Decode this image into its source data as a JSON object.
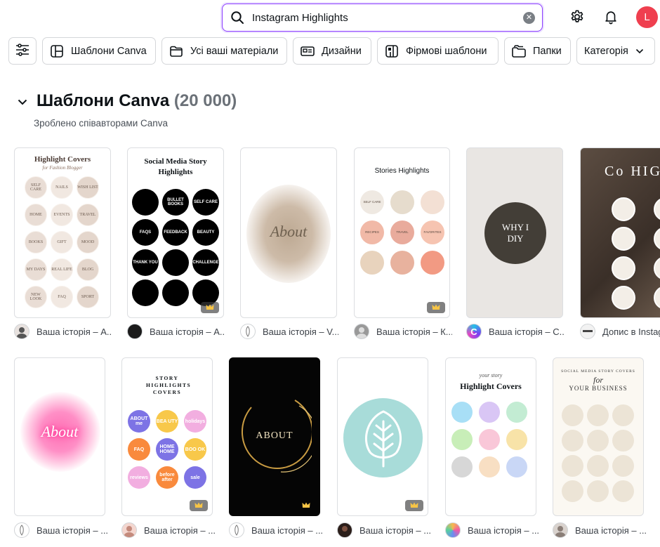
{
  "search": {
    "value": "Instagram Highlights",
    "placeholder": "Instagram Highlights"
  },
  "header": {
    "avatar_letter": "L"
  },
  "filters": [
    {
      "label": "Шаблони Canva"
    },
    {
      "label": "Усі ваші матеріали"
    },
    {
      "label": "Дизайни"
    },
    {
      "label": "Фірмові шаблони"
    },
    {
      "label": "Папки"
    },
    {
      "label": "Категорія"
    }
  ],
  "section": {
    "title": "Шаблони Canva",
    "count": "(20 000)",
    "subtitle": "Зроблено співавторами Canva"
  },
  "cards": [
    {
      "caption": "Ваша історія – А...",
      "title": "Highlight Covers",
      "subtitle": "for Fashion Blogger",
      "labels": [
        "SELF CARE",
        "NAILS",
        "WISH LIST",
        "HOME",
        "EVENTS",
        "TRAVEL",
        "BOOKS",
        "GIFT",
        "MOOD",
        "MY DAYS",
        "REAL LIFE",
        "BLOG",
        "NEW LOOK",
        "FAQ",
        "SPORT"
      ]
    },
    {
      "caption": "Ваша історія – А...",
      "title": "Social Media Story Highlights",
      "labels": [
        "",
        "BULLET BOOKS",
        "SELF CARE",
        "FAQS",
        "FEEDBACK",
        "BEAUTY",
        "THANK YOU",
        "",
        "CHALLENGE",
        "",
        "",
        ""
      ]
    },
    {
      "caption": "Ваша історія – V...",
      "word": "About"
    },
    {
      "caption": "Ваша історія – К...",
      "title": "Stories Highlights",
      "labels": [
        "SELF CARE",
        "",
        "",
        "RECIPES",
        "TRAVEL",
        "FAVORITES",
        "",
        "",
        ""
      ]
    },
    {
      "caption": "Ваша історія – С...",
      "word": "WHY I DIY"
    },
    {
      "caption": "Допис в Instagram",
      "title": "Co HIGHLI"
    },
    {
      "caption": "Ваша історія – ...",
      "word": "About"
    },
    {
      "caption": "Ваша історія – ...",
      "title": "STORY HIGHLIGHTS COVERS",
      "labels": [
        "ABOUT me",
        "BEA UTY",
        "holidays",
        "FAQ",
        "HOME HOME",
        "BOO OK",
        "reviews",
        "before after",
        "sale"
      ]
    },
    {
      "caption": "Ваша історія – ...",
      "word": "ABOUT"
    },
    {
      "caption": "Ваша історія – ..."
    },
    {
      "caption": "Ваша історія – ...",
      "title": "Highlight Covers",
      "subtitle": "your story"
    },
    {
      "caption": "Ваша історія – ...",
      "title": "YOUR BUSINESS",
      "subtitle": "SOCIAL MEDIA STORY COVERS",
      "word": "for"
    }
  ],
  "colors": {
    "accent": "#8b3dff",
    "avatar": "#ef3f4f"
  }
}
